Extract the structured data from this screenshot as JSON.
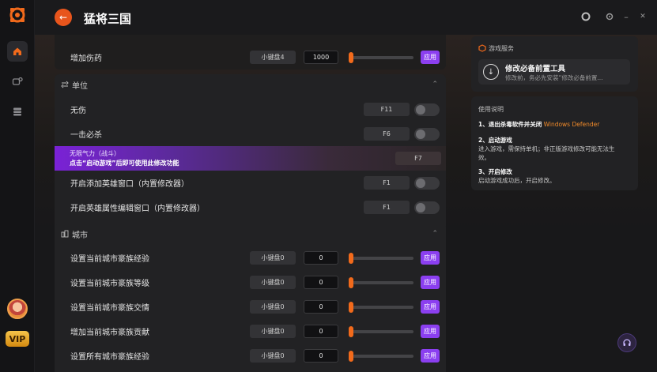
{
  "app": {
    "title": "猛将三国"
  },
  "colors": {
    "accent": "#f26a1b",
    "apply_button": "#8b3ff0",
    "promo_start": "#7a22d6",
    "vip_gold": "#f5c34a"
  },
  "rail": {
    "vip_label": "VIP"
  },
  "top_rows": [
    {
      "label": "增加伤药",
      "hotkey": "小键盘4",
      "value": "1000",
      "apply": "应用"
    }
  ],
  "units_section": {
    "title": "单位",
    "rows": [
      {
        "label": "无伤",
        "hotkey": "F11"
      },
      {
        "label": "一击必杀",
        "hotkey": "F6"
      }
    ],
    "promo": {
      "line1": "无限气力（战斗）",
      "line2": "点击“启动游戏”后即可使用此修改功能",
      "hotkey": "F7"
    },
    "rows_after": [
      {
        "label": "开启添加英雄窗口（内置修改器）",
        "hotkey": "F1"
      },
      {
        "label": "开启英雄属性编辑窗口（内置修改器）",
        "hotkey": "F1"
      }
    ]
  },
  "city_section": {
    "title": "城市",
    "rows": [
      {
        "label": "设置当前城市豪族经验",
        "hotkey": "小键盘0",
        "value": "0",
        "apply": "应用"
      },
      {
        "label": "设置当前城市豪族等级",
        "hotkey": "小键盘0",
        "value": "0",
        "apply": "应用"
      },
      {
        "label": "设置当前城市豪族交情",
        "hotkey": "小键盘0",
        "value": "0",
        "apply": "应用"
      },
      {
        "label": "增加当前城市豪族贡献",
        "hotkey": "小键盘0",
        "value": "0",
        "apply": "应用"
      },
      {
        "label": "设置所有城市豪族经验",
        "hotkey": "小键盘0",
        "value": "0",
        "apply": "应用"
      }
    ]
  },
  "service_card": {
    "title": "游戏服务",
    "tool_name": "修改必备前置工具",
    "tool_desc": "修改前，务必先安装“修改必备前置..."
  },
  "instructions_card": {
    "title": "使用说明",
    "step1_title": "1、退出杀毒软件并关闭",
    "step1_highlight": "Windows Defender",
    "step2_title": "2、启动游戏",
    "step2_text": "进入游戏，需保持单机；非正版游戏修改可能无法生效。",
    "step3_title": "3、开启修改",
    "step3_text": "启动游戏成功后，开启修改。"
  }
}
